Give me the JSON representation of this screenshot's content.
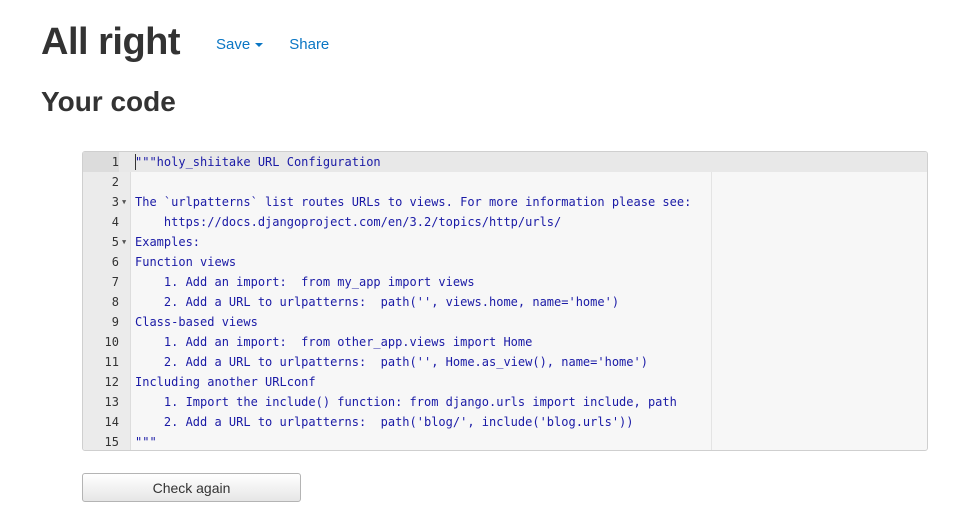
{
  "header": {
    "title": "All right",
    "save_label": "Save",
    "share_label": "Share"
  },
  "subtitle": "Your code",
  "editor": {
    "lines": [
      {
        "num": "1",
        "text": "\"\"\"holy_shiitake URL Configuration",
        "fold": false,
        "active": true
      },
      {
        "num": "2",
        "text": "",
        "fold": false,
        "active": false
      },
      {
        "num": "3",
        "text": "The `urlpatterns` list routes URLs to views. For more information please see:",
        "fold": true,
        "active": false
      },
      {
        "num": "4",
        "text": "    https://docs.djangoproject.com/en/3.2/topics/http/urls/",
        "fold": false,
        "active": false
      },
      {
        "num": "5",
        "text": "Examples:",
        "fold": true,
        "active": false
      },
      {
        "num": "6",
        "text": "Function views",
        "fold": false,
        "active": false
      },
      {
        "num": "7",
        "text": "    1. Add an import:  from my_app import views",
        "fold": false,
        "active": false
      },
      {
        "num": "8",
        "text": "    2. Add a URL to urlpatterns:  path('', views.home, name='home')",
        "fold": false,
        "active": false
      },
      {
        "num": "9",
        "text": "Class-based views",
        "fold": false,
        "active": false
      },
      {
        "num": "10",
        "text": "    1. Add an import:  from other_app.views import Home",
        "fold": false,
        "active": false
      },
      {
        "num": "11",
        "text": "    2. Add a URL to urlpatterns:  path('', Home.as_view(), name='home')",
        "fold": false,
        "active": false
      },
      {
        "num": "12",
        "text": "Including another URLconf",
        "fold": false,
        "active": false
      },
      {
        "num": "13",
        "text": "    1. Import the include() function: from django.urls import include, path",
        "fold": false,
        "active": false
      },
      {
        "num": "14",
        "text": "    2. Add a URL to urlpatterns:  path('blog/', include('blog.urls'))",
        "fold": false,
        "active": false
      },
      {
        "num": "15",
        "text": "\"\"\"",
        "fold": false,
        "active": false
      }
    ]
  },
  "check_button_label": "Check again",
  "colors": {
    "link": "#0a76c4",
    "code_text": "#1a1aa6",
    "heading": "#333333"
  },
  "icons": {
    "save_dropdown": "chevron-down-icon",
    "fold_marker": "fold-arrow-icon"
  }
}
